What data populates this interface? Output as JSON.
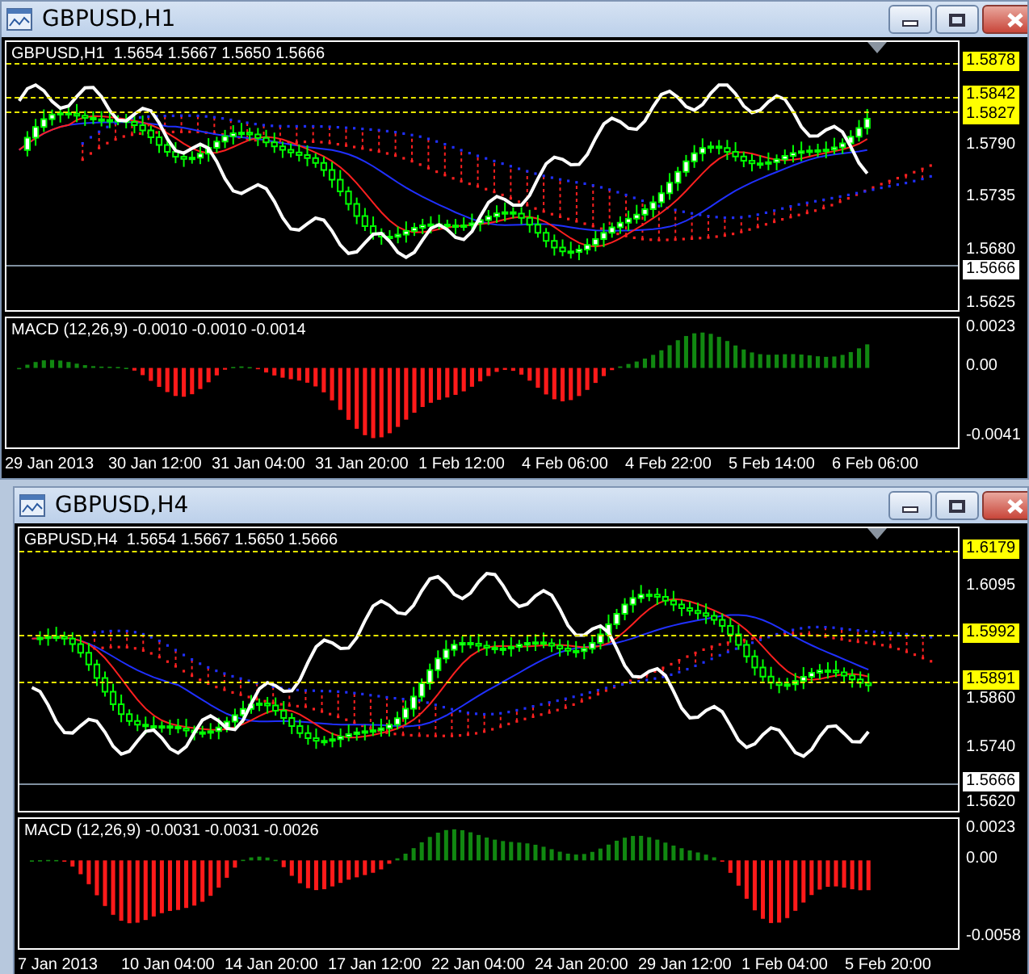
{
  "windows": [
    {
      "title": "GBPUSD,H1",
      "quote": "GBPUSD,H1  1.5654 1.5667 1.5650 1.5666",
      "price_ticks": [
        "1.5790",
        "1.5735",
        "1.5680",
        "1.5625"
      ],
      "levels": [
        "1.5878",
        "1.5842",
        "1.5827"
      ],
      "current_price": "1.5666",
      "indicator": {
        "label": "MACD (12,26,9) -0.0010 -0.0010 -0.0014",
        "ticks": [
          "0.0023",
          "0.00",
          "-0.0041"
        ]
      },
      "time_ticks": [
        "29 Jan 2013",
        "30 Jan 12:00",
        "31 Jan 04:00",
        "31 Jan 20:00",
        "1 Feb 12:00",
        "4 Feb 06:00",
        "4 Feb 22:00",
        "5 Feb 14:00",
        "6 Feb 06:00"
      ]
    },
    {
      "title": "GBPUSD,H4",
      "quote": "GBPUSD,H4  1.5654 1.5667 1.5650 1.5666",
      "price_ticks": [
        "1.6095",
        "1.5860",
        "1.5740",
        "1.5620"
      ],
      "levels": [
        "1.6179",
        "1.5992",
        "1.5891"
      ],
      "current_price": "1.5666",
      "indicator": {
        "label": "MACD (12,26,9) -0.0031 -0.0031 -0.0026",
        "ticks": [
          "0.0023",
          "0.00",
          "-0.0058"
        ]
      },
      "time_ticks": [
        "7 Jan 2013",
        "10 Jan 04:00",
        "14 Jan 20:00",
        "17 Jan 12:00",
        "22 Jan 04:00",
        "24 Jan 20:00",
        "29 Jan 12:00",
        "1 Feb 04:00",
        "5 Feb 20:00"
      ]
    }
  ]
}
